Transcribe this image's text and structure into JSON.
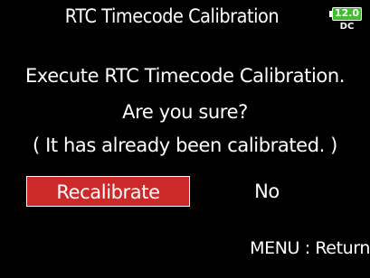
{
  "screen": {
    "title": "RTC Timecode Calibration",
    "battery": {
      "value": "12.0",
      "source": "DC",
      "color": "#3fbf2e"
    },
    "message": {
      "line1": "Execute RTC Timecode Calibration.",
      "line2": "Are you sure?",
      "line3": "( It has already been calibrated. )"
    },
    "buttons": {
      "recalibrate": "Recalibrate",
      "no": "No"
    },
    "footer": "MENU : Return",
    "accent_color": "#cc2a2a"
  }
}
